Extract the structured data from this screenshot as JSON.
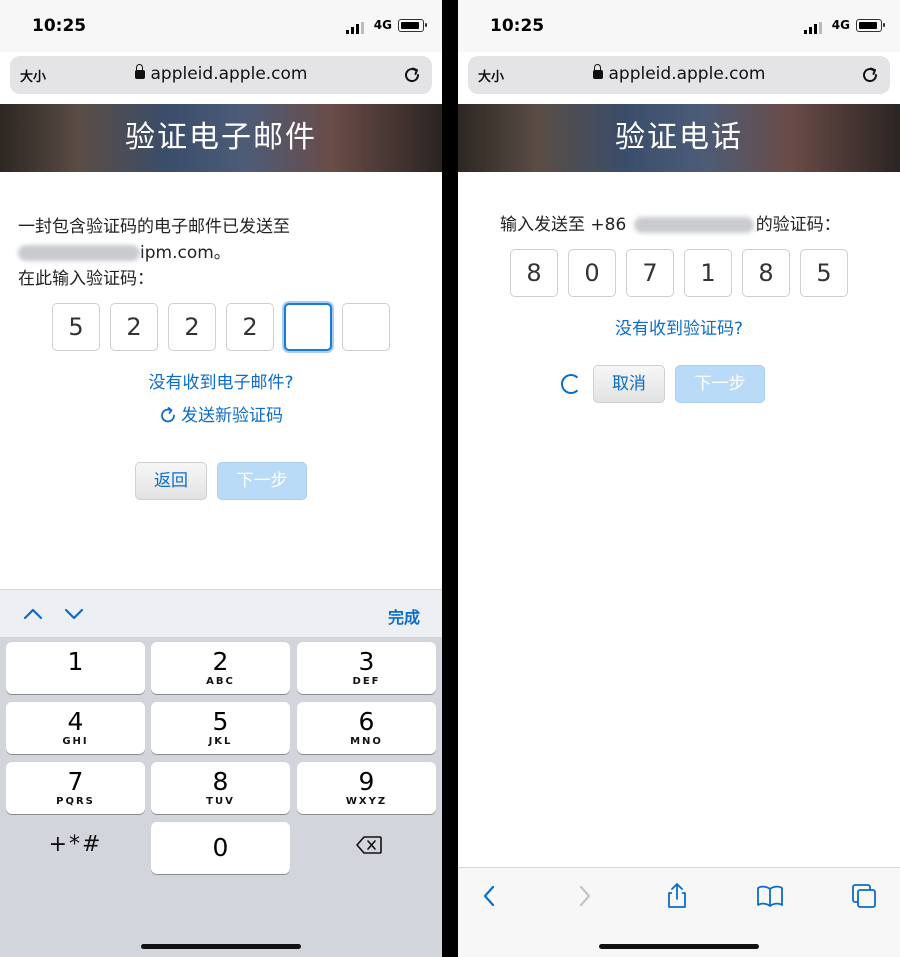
{
  "status": {
    "time": "10:25",
    "network": "4G"
  },
  "browser": {
    "text_size": "大小",
    "url": "appleid.apple.com"
  },
  "left": {
    "title": "验证电子邮件",
    "message_line1": "一封包含验证码的电子邮件已发送至",
    "message_email_suffix": "ipm.com。",
    "message_line3": "在此输入验证码：",
    "code": [
      "5",
      "2",
      "2",
      "2",
      "",
      ""
    ],
    "no_email_link": "没有收到电子邮件?",
    "resend_link": "发送新验证码",
    "back_button": "返回",
    "next_button": "下一步"
  },
  "keyboard": {
    "done": "完成",
    "keys": [
      {
        "num": "1",
        "letters": ""
      },
      {
        "num": "2",
        "letters": "ABC"
      },
      {
        "num": "3",
        "letters": "DEF"
      },
      {
        "num": "4",
        "letters": "GHI"
      },
      {
        "num": "5",
        "letters": "JKL"
      },
      {
        "num": "6",
        "letters": "MNO"
      },
      {
        "num": "7",
        "letters": "PQRS"
      },
      {
        "num": "8",
        "letters": "TUV"
      },
      {
        "num": "9",
        "letters": "WXYZ"
      }
    ],
    "symbols": "+*#",
    "zero": "0"
  },
  "right": {
    "title": "验证电话",
    "message_prefix": "输入发送至 +86",
    "message_suffix": "的验证码：",
    "code": [
      "8",
      "0",
      "7",
      "1",
      "8",
      "5"
    ],
    "no_code_link": "没有收到验证码?",
    "cancel_button": "取消",
    "next_button": "下一步"
  }
}
